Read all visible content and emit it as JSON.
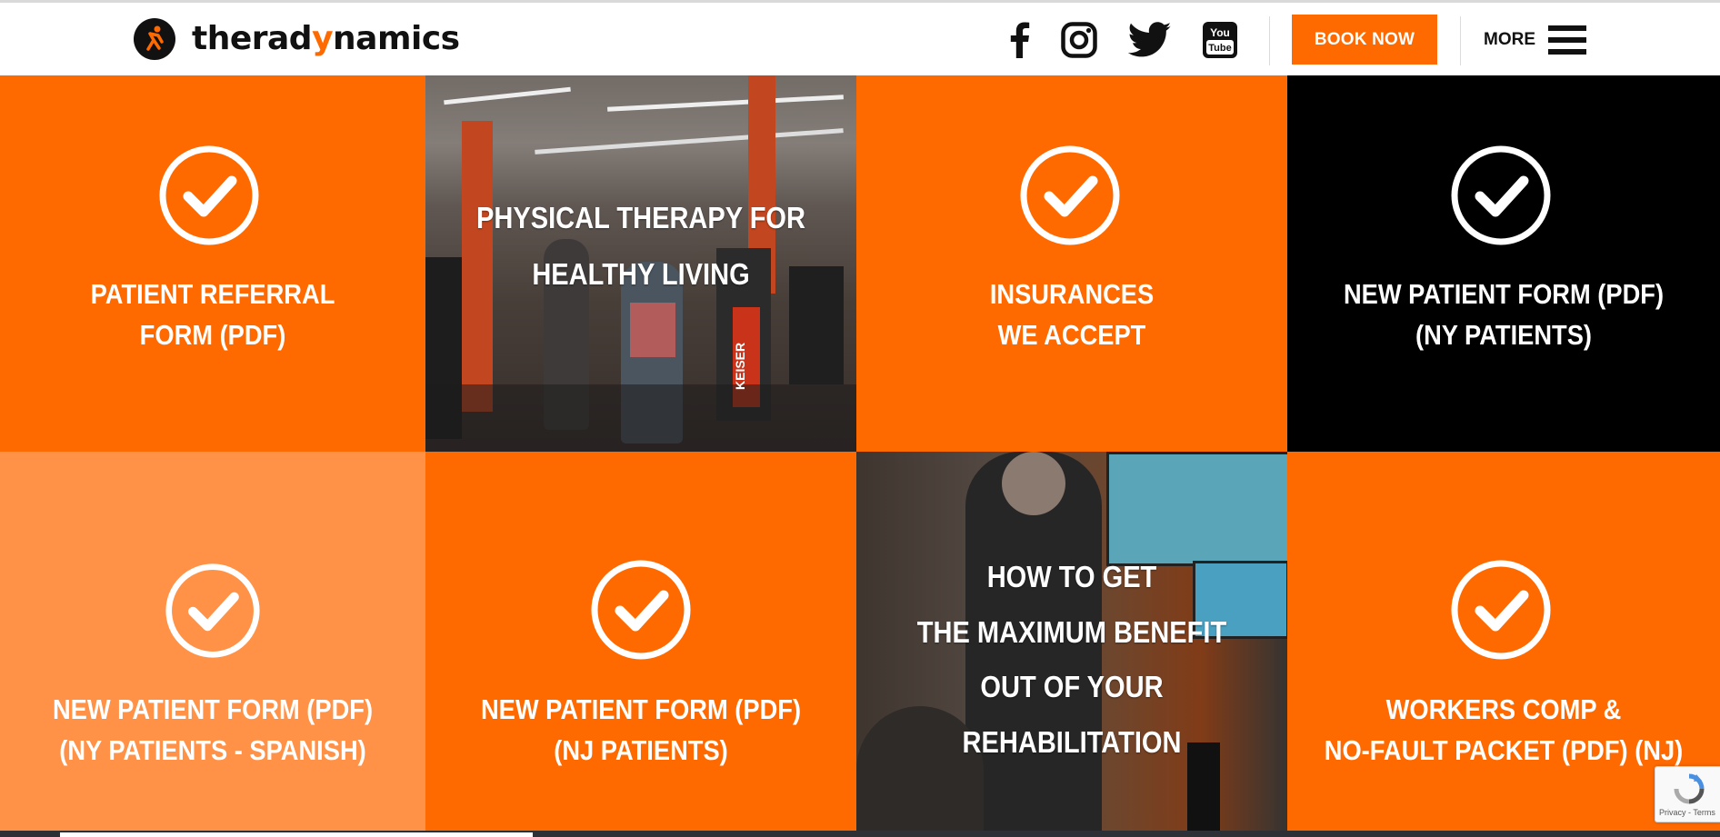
{
  "header": {
    "logo": {
      "text_pre": "therad",
      "text_accent": "y",
      "text_post": "namics"
    },
    "social": [
      {
        "name": "facebook-icon"
      },
      {
        "name": "instagram-icon"
      },
      {
        "name": "twitter-icon"
      },
      {
        "name": "youtube-icon",
        "text_top": "You",
        "text_bottom": "Tube"
      }
    ],
    "book_label": "BOOK NOW",
    "more_label": "MORE"
  },
  "tiles": [
    {
      "lines": [
        "PATIENT REFERRAL",
        "FORM (PDF)"
      ]
    },
    {
      "lines": [
        "PHYSICAL THERAPY FOR",
        "HEALTHY LIVING"
      ]
    },
    {
      "lines": [
        "INSURANCES",
        "WE ACCEPT"
      ]
    },
    {
      "lines": [
        "NEW PATIENT FORM (PDF)",
        "(NY PATIENTS)"
      ]
    },
    {
      "lines": [
        "NEW PATIENT FORM (PDF)",
        "(NY PATIENTS - SPANISH)"
      ]
    },
    {
      "lines": [
        "NEW PATIENT FORM (PDF)",
        "(NJ PATIENTS)"
      ]
    },
    {
      "lines": [
        "HOW TO GET",
        "THE MAXIMUM BENEFIT",
        "OUT OF YOUR",
        "REHABILITATION"
      ]
    },
    {
      "lines": [
        "WORKERS COMP &",
        "NO-FAULT PACKET (PDF) (NJ)"
      ]
    }
  ],
  "gym_brand_text": "KEISER",
  "recaptcha": {
    "terms": "Privacy - Terms"
  },
  "colors": {
    "accent": "#ff6a00",
    "accent_light": "#ff9246",
    "dark": "#000000"
  }
}
